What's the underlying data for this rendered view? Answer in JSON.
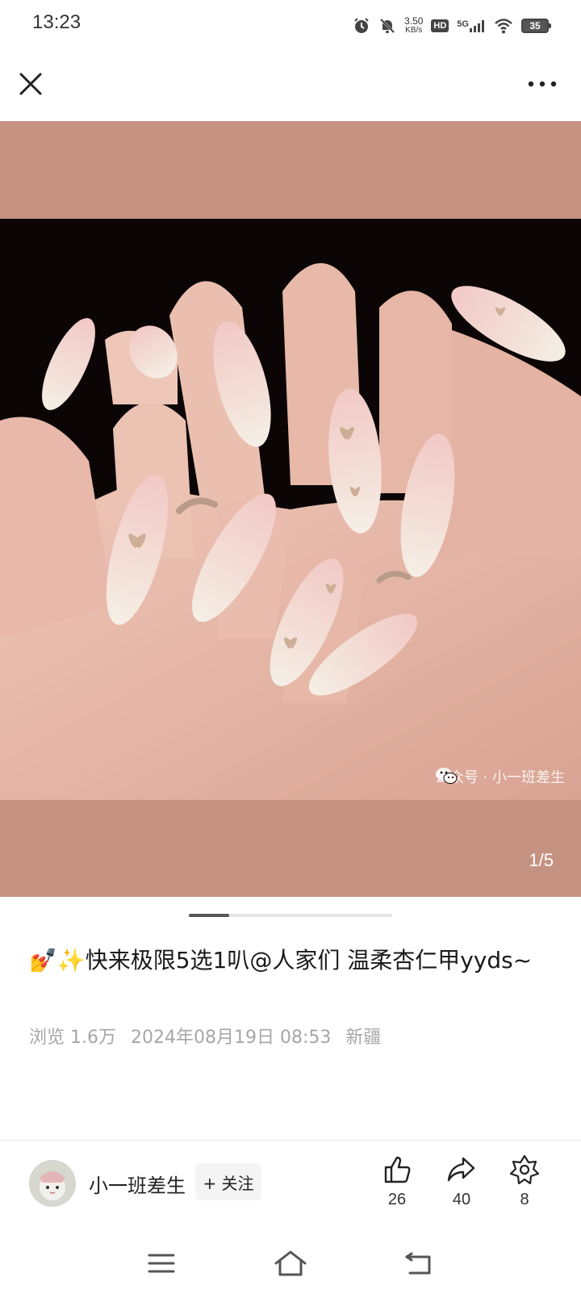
{
  "status_bar": {
    "time": "13:23",
    "net_speed_value": "3.50",
    "net_speed_unit": "KB/s",
    "hd_label": "HD",
    "network_label": "5G",
    "battery_level": "35",
    "icons": [
      "alarm-icon",
      "silent-bell-icon",
      "hd-icon",
      "signal-5g-icon",
      "wifi-icon",
      "battery-icon"
    ]
  },
  "top_nav": {
    "close_icon": "close-icon",
    "more_icon": "more-icon"
  },
  "media": {
    "watermark_text": "公众号 · 小一班差生",
    "page_indicator": "1/5",
    "background_color": "#c59282",
    "carousel_progress": 0.2
  },
  "post": {
    "title": "💅✨快来极限5选1叭@人家们 温柔杏仁甲yyds~",
    "views": "浏览 1.6万",
    "date": "2024年08月19日 08:53",
    "location": "新疆"
  },
  "author_bar": {
    "name": "小一班差生",
    "follow_label": "+ 关注",
    "like_count": "26",
    "share_count": "40",
    "favorite_count": "8"
  },
  "system_nav": {
    "icons": [
      "menu-icon",
      "home-icon",
      "back-icon"
    ]
  }
}
